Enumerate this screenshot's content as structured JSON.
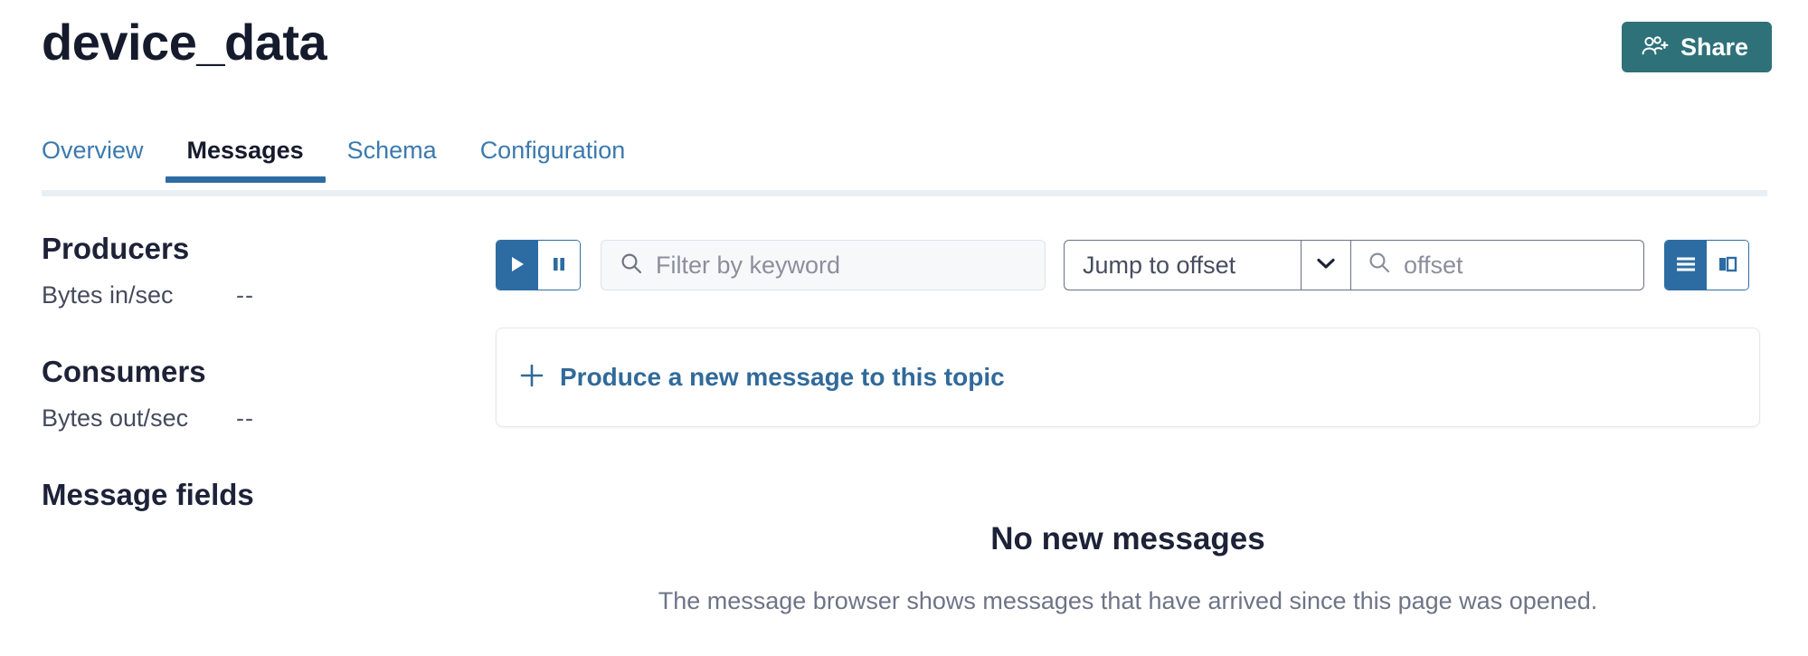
{
  "header": {
    "title": "device_data",
    "share_label": "Share",
    "share_icon": "users-plus-icon",
    "share_color": "#2e7179"
  },
  "tabs": [
    {
      "label": "Overview",
      "active": false
    },
    {
      "label": "Messages",
      "active": true
    },
    {
      "label": "Schema",
      "active": false
    },
    {
      "label": "Configuration",
      "active": false
    }
  ],
  "sidebar": {
    "producers": {
      "heading": "Producers",
      "metric_label": "Bytes in/sec",
      "metric_value": "--"
    },
    "consumers": {
      "heading": "Consumers",
      "metric_label": "Bytes out/sec",
      "metric_value": "--"
    },
    "message_fields": {
      "heading": "Message fields"
    }
  },
  "toolbar": {
    "play_icon": "play-icon",
    "pause_icon": "pause-icon",
    "play_active": true,
    "search_icon": "search-icon",
    "filter_placeholder": "Filter by keyword",
    "filter_value": "",
    "jump_to_offset_label": "Jump to offset",
    "jump_caret_icon": "chevron-down-icon",
    "offset_placeholder": "offset",
    "offset_value": "",
    "view_list_icon": "list-view-icon",
    "view_split_icon": "split-view-icon",
    "view_list_active": true,
    "accent_color": "#2d6ca2"
  },
  "produce": {
    "icon": "plus-icon",
    "label": "Produce a new message to this topic"
  },
  "empty_state": {
    "title": "No new messages",
    "description": "The message browser shows messages that have arrived since this page was opened."
  }
}
